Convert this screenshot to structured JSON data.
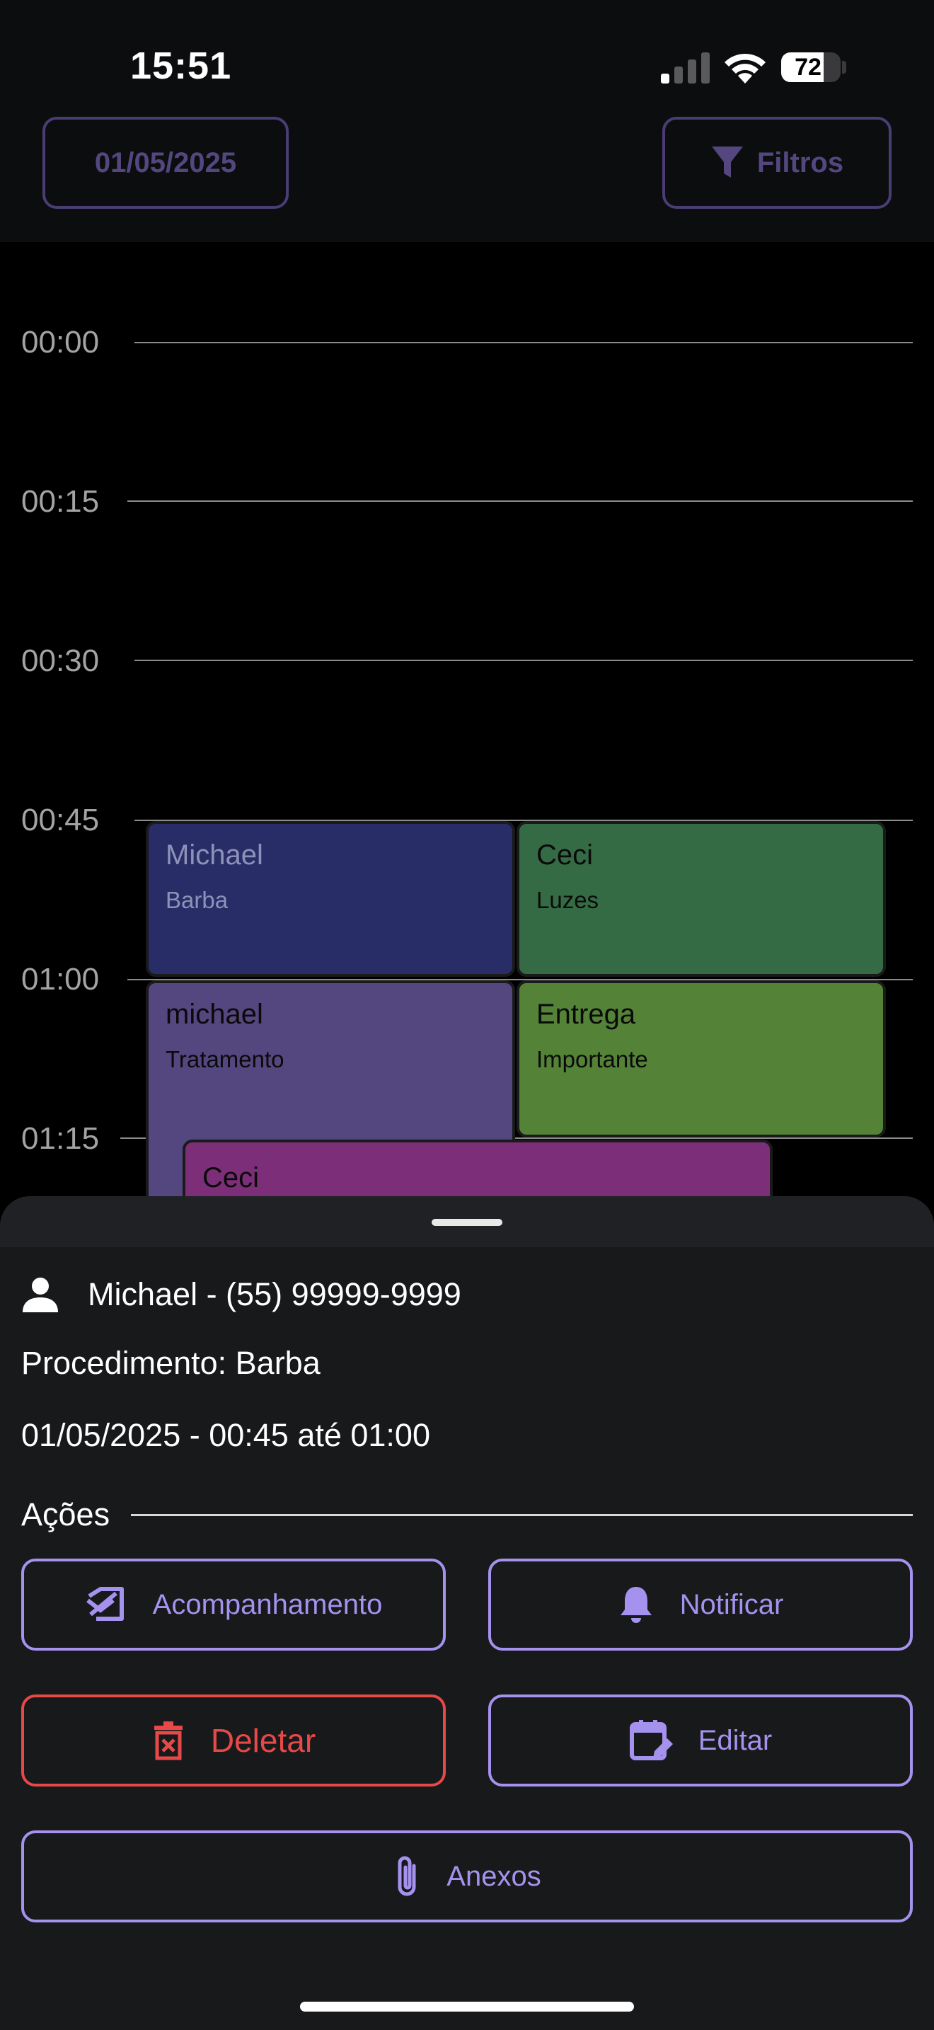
{
  "status_bar": {
    "time": "15:51",
    "battery": "72",
    "battery_level": 0.72
  },
  "header": {
    "date": "01/05/2025",
    "filter_label": "Filtros"
  },
  "timeline": {
    "times": [
      "00:00",
      "00:15",
      "00:30",
      "00:45",
      "01:00",
      "01:15"
    ],
    "events": [
      {
        "name": "Michael",
        "sub": "Barba",
        "bg": "#282d68",
        "fg": "#8d92b8"
      },
      {
        "name": "Ceci",
        "sub": "Luzes",
        "bg": "#356b44",
        "fg": "#0a0a0a"
      },
      {
        "name": "michael",
        "sub": "Tratamento",
        "bg": "#54467f",
        "fg": "#0a0a0a"
      },
      {
        "name": "Entrega",
        "sub": "Importante",
        "bg": "#548236",
        "fg": "#0a0a0a"
      },
      {
        "name": "Ceci",
        "sub": "",
        "bg": "#7c2f78",
        "fg": "#0a0a0a"
      }
    ]
  },
  "sheet": {
    "client": "Michael - (55) 99999-9999",
    "procedure": "Procedimento: Barba",
    "datetime": "01/05/2025 - 00:45 até 01:00",
    "section_label": "Ações",
    "actions": {
      "follow_up": "Acompanhamento",
      "notify": "Notificar",
      "delete": "Deletar",
      "edit": "Editar",
      "attachments": "Anexos"
    }
  },
  "colors": {
    "accent": "#a592ee",
    "danger": "#e74848",
    "header_accent": "#54467f"
  }
}
